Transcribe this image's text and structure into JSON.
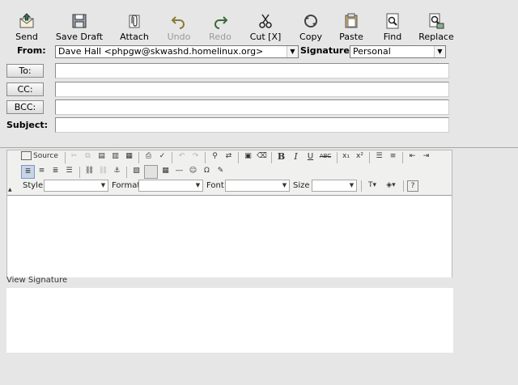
{
  "toolbar": {
    "send": "Send",
    "save_draft": "Save Draft",
    "attach": "Attach",
    "undo": "Undo",
    "redo": "Redo",
    "cut": "Cut [X]",
    "copy": "Copy",
    "paste": "Paste",
    "find": "Find",
    "replace": "Replace"
  },
  "form": {
    "from_label": "From:",
    "from_value": "Dave Hall <phpgw@skwashd.homelinux.org>",
    "signature_label": "Signature:",
    "signature_value": "Personal",
    "to_button": "To:",
    "cc_button": "CC:",
    "bcc_button": "BCC:",
    "subject_label": "Subject:",
    "to_value": "",
    "cc_value": "",
    "bcc_value": "",
    "subject_value": ""
  },
  "editor": {
    "source_label": "Source",
    "bold": "B",
    "italic": "I",
    "underline": "U",
    "strike": "ABC",
    "subscript": "x₁",
    "superscript": "x²",
    "style_label": "Style",
    "format_label": "Format",
    "font_label": "Font",
    "size_label": "Size",
    "style_value": "",
    "format_value": "",
    "font_value": "",
    "size_value": ""
  },
  "signature": {
    "view_label": "View Signature"
  }
}
